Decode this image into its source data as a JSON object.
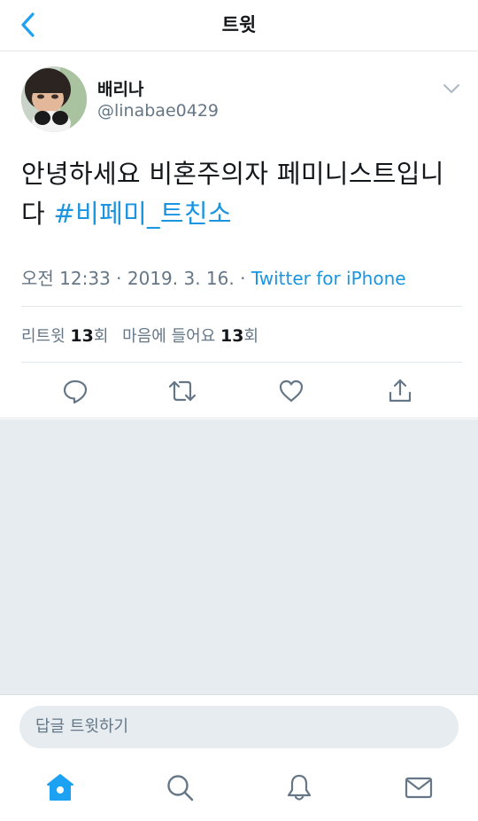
{
  "header": {
    "title": "트윗",
    "back_icon": "chevron-left-icon"
  },
  "tweet": {
    "author": {
      "name": "배리나",
      "handle": "@linabae0429"
    },
    "text_plain": "안녕하세요 비혼주의자 페미니스트입니다",
    "hashtag": "#비페미_트친소",
    "timestamp": "오전 12:33 · 2019. 3. 16.",
    "source_sep": " · ",
    "source": "Twitter for iPhone",
    "stats": {
      "retweets_label": "리트윗",
      "retweets_count": "13",
      "retweets_unit": "회",
      "likes_label": "마음에 들어요",
      "likes_count": "13",
      "likes_unit": "회"
    },
    "actions": [
      "reply-icon",
      "retweet-icon",
      "heart-icon",
      "share-icon"
    ]
  },
  "reply": {
    "placeholder": "답글 트윗하기"
  },
  "tabbar": {
    "items": [
      "home-icon",
      "search-icon",
      "notifications-bell-icon",
      "messages-envelope-icon"
    ],
    "active": "home-icon"
  },
  "colors": {
    "accent": "#1da1f2",
    "link": "#1b95e0",
    "secondary_text": "#657786",
    "background_gray": "#e6ecf0"
  }
}
